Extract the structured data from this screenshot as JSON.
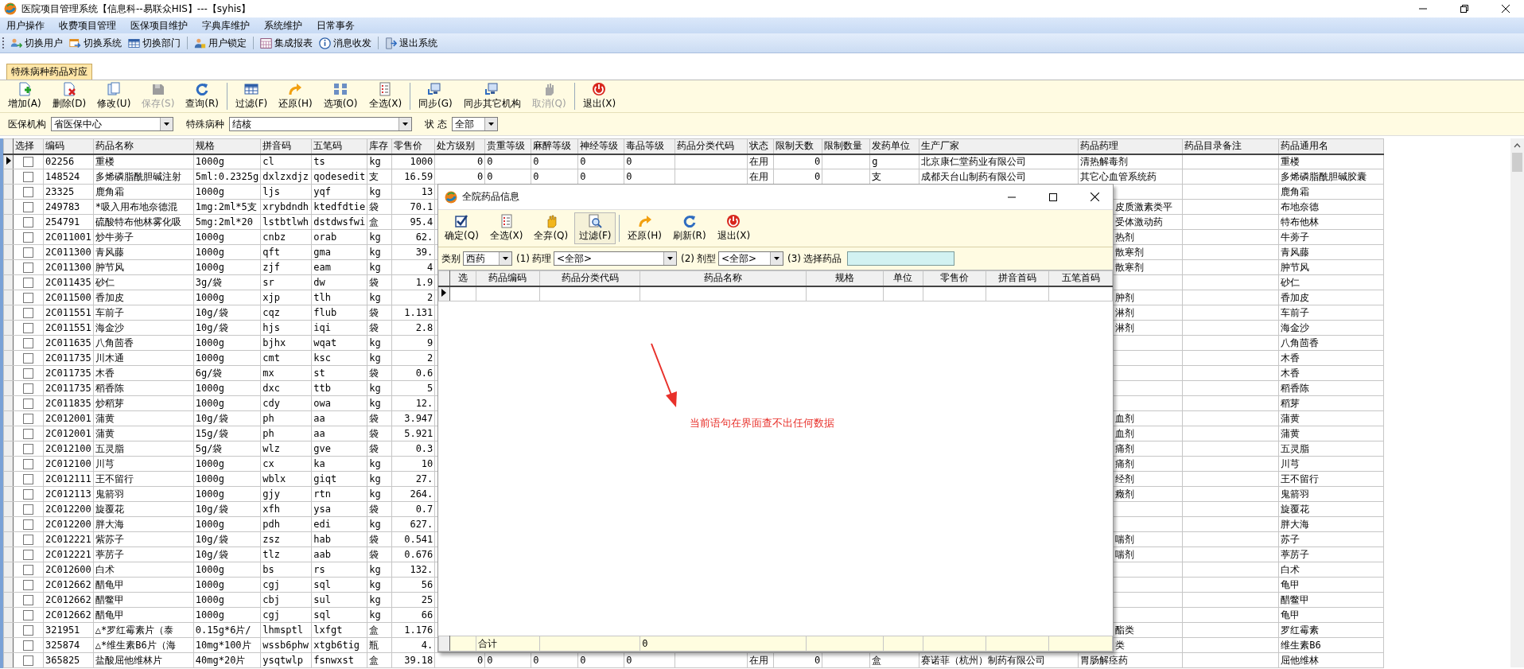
{
  "window": {
    "title": "医院项目管理系统【信息科--易联众HIS】---【syhis】"
  },
  "menu": [
    "用户操作",
    "收费项目管理",
    "医保项目维护",
    "字典库维护",
    "系统维护",
    "日常事务"
  ],
  "quickbar": [
    [
      "切换用户",
      "切换系统",
      "切换部门"
    ],
    [
      "用户锁定"
    ],
    [
      "集成报表",
      "消息收发"
    ],
    [
      "退出系统"
    ]
  ],
  "tabs": [
    {
      "label": "特殊病种药品对应",
      "selected": true
    }
  ],
  "actions": [
    [
      {
        "label": "增加(A)",
        "disabled": false
      },
      {
        "label": "删除(D)",
        "disabled": false
      },
      {
        "label": "修改(U)",
        "disabled": false
      },
      {
        "label": "保存(S)",
        "disabled": true
      },
      {
        "label": "查询(R)",
        "disabled": false
      }
    ],
    [
      {
        "label": "过滤(F)",
        "disabled": false
      },
      {
        "label": "还原(H)",
        "disabled": false
      },
      {
        "label": "选项(O)",
        "disabled": false
      },
      {
        "label": "全选(X)",
        "disabled": false
      }
    ],
    [
      {
        "label": "同步(G)",
        "disabled": false
      },
      {
        "label": "同步其它机构",
        "disabled": false
      },
      {
        "label": "取消(Q)",
        "disabled": true
      }
    ],
    [
      {
        "label": "退出(X)",
        "disabled": false
      }
    ]
  ],
  "filters": [
    {
      "label": "医保机构",
      "value": "省医保中心"
    },
    {
      "label": "特殊病种",
      "value": "结核"
    },
    {
      "label": "状 态",
      "value": "全部"
    }
  ],
  "grid": {
    "checkbox_column": "选择",
    "columns": [
      "编码",
      "药品名称",
      "规格",
      "拼音码",
      "五笔码",
      "库存",
      "零售价",
      "处方级别",
      "贵重等级",
      "麻醉等级",
      "神经等级",
      "毒品等级",
      "药品分类代码",
      "状态",
      "限制天数",
      "限制数量",
      "发药单位",
      "生产厂家",
      "药品药理",
      "药品目录备注",
      "药品通用名"
    ],
    "rows": [
      {
        "selected": true,
        "checked": false,
        "cells": [
          "02256",
          "重楼",
          "1000g",
          "cl",
          "ts",
          "kg",
          "1000"
        ],
        "middle": {
          "rx_level": "0",
          "value_level": "0",
          "narcotic_level": "0",
          "neuro_level": "0",
          "poison_level": "0",
          "status": "在用",
          "limit_days": "0",
          "dispense_unit": "g",
          "manufacturer": "北京康仁堂药业有限公司"
        },
        "pharmacology": "清热解毒剂",
        "common_name": "重楼"
      },
      {
        "selected": false,
        "checked": false,
        "cells": [
          "148524",
          "多烯磷脂酰胆碱注射",
          "5ml:0.2325g",
          "dxlzxdjz",
          "qodesedit",
          "支",
          "16.59"
        ],
        "middle": {
          "rx_level": "0",
          "value_level": "0",
          "narcotic_level": "0",
          "neuro_level": "0",
          "poison_level": "0",
          "status": "在用",
          "limit_days": "0",
          "dispense_unit": "支",
          "manufacturer": "成都天台山制药有限公司"
        },
        "pharmacology": "其它心血管系统药",
        "common_name": "多烯磷脂酰胆碱胶囊"
      },
      {
        "selected": false,
        "checked": false,
        "cells": [
          "23325",
          "鹿角霜",
          "1000g",
          "ljs",
          "yqf",
          "kg",
          "13"
        ],
        "common_name": "鹿角霜"
      },
      {
        "selected": false,
        "checked": false,
        "cells": [
          "249783",
          "*吸入用布地奈德混",
          "1mg:2ml*5支",
          "xrybdndh",
          "ktedfdtie",
          "袋",
          "70.1"
        ],
        "pharmacology": "皮质激素类平",
        "common_name": "布地奈德"
      },
      {
        "selected": false,
        "checked": false,
        "cells": [
          "254791",
          "硫酸特布他林雾化吸",
          "5mg:2ml*20",
          "lstbtlwh",
          "dstdwsfwi",
          "盒",
          "95.4"
        ],
        "pharmacology": "受体激动药",
        "common_name": "特布他林"
      },
      {
        "selected": false,
        "checked": false,
        "cells": [
          "2C011001",
          "炒牛蒡子",
          "1000g",
          "cnbz",
          "orab",
          "kg",
          "62."
        ],
        "pharmacology": "热剂",
        "common_name": "牛蒡子"
      },
      {
        "selected": false,
        "checked": false,
        "cells": [
          "2C011300",
          "青风藤",
          "1000g",
          "qft",
          "gma",
          "kg",
          "39."
        ],
        "pharmacology": "散寒剂",
        "common_name": "青风藤"
      },
      {
        "selected": false,
        "checked": false,
        "cells": [
          "2C011300",
          "肿节风",
          "1000g",
          "zjf",
          "eam",
          "kg",
          "4"
        ],
        "pharmacology": "散寒剂",
        "common_name": "肿节风"
      },
      {
        "selected": false,
        "checked": false,
        "cells": [
          "2C011435",
          "砂仁",
          "3g/袋",
          "sr",
          "dw",
          "袋",
          "1.9"
        ],
        "common_name": "砂仁"
      },
      {
        "selected": false,
        "checked": false,
        "cells": [
          "2C011500",
          "香加皮",
          "1000g",
          "xjp",
          "tlh",
          "kg",
          "2"
        ],
        "pharmacology": "肿剂",
        "common_name": "香加皮"
      },
      {
        "selected": false,
        "checked": false,
        "cells": [
          "2C011551",
          "车前子",
          "10g/袋",
          "cqz",
          "flub",
          "袋",
          "1.131"
        ],
        "pharmacology": "淋剂",
        "common_name": "车前子"
      },
      {
        "selected": false,
        "checked": false,
        "cells": [
          "2C011551",
          "海金沙",
          "10g/袋",
          "hjs",
          "iqi",
          "袋",
          "2.8"
        ],
        "pharmacology": "淋剂",
        "common_name": "海金沙"
      },
      {
        "selected": false,
        "checked": false,
        "cells": [
          "2C011635",
          "八角茴香",
          "1000g",
          "bjhx",
          "wqat",
          "kg",
          "9"
        ],
        "common_name": "八角茴香"
      },
      {
        "selected": false,
        "checked": false,
        "cells": [
          "2C011735",
          "川木通",
          "1000g",
          "cmt",
          "ksc",
          "kg",
          "2"
        ],
        "common_name": "木香"
      },
      {
        "selected": false,
        "checked": false,
        "cells": [
          "2C011735",
          "木香",
          "6g/袋",
          "mx",
          "st",
          "袋",
          "0.6"
        ],
        "common_name": "木香"
      },
      {
        "selected": false,
        "checked": false,
        "cells": [
          "2C011735",
          "稻香陈",
          "1000g",
          "dxc",
          "ttb",
          "kg",
          "5"
        ],
        "common_name": "稻香陈"
      },
      {
        "selected": false,
        "checked": false,
        "cells": [
          "2C011835",
          "炒稻芽",
          "1000g",
          "cdy",
          "owa",
          "kg",
          "12."
        ],
        "common_name": "稻芽"
      },
      {
        "selected": false,
        "checked": false,
        "cells": [
          "2C012001",
          "蒲黄",
          "10g/袋",
          "ph",
          "aa",
          "袋",
          "3.947"
        ],
        "pharmacology": "血剂",
        "common_name": "蒲黄"
      },
      {
        "selected": false,
        "checked": false,
        "cells": [
          "2C012001",
          "蒲黄",
          "15g/袋",
          "ph",
          "aa",
          "袋",
          "5.921"
        ],
        "pharmacology": "血剂",
        "common_name": "蒲黄"
      },
      {
        "selected": false,
        "checked": false,
        "cells": [
          "2C012100",
          "五灵脂",
          "5g/袋",
          "wlz",
          "gve",
          "袋",
          "0.3"
        ],
        "pharmacology": "痛剂",
        "common_name": "五灵脂"
      },
      {
        "selected": false,
        "checked": false,
        "cells": [
          "2C012100",
          "川芎",
          "1000g",
          "cx",
          "ka",
          "kg",
          "10"
        ],
        "pharmacology": "痛剂",
        "common_name": "川芎"
      },
      {
        "selected": false,
        "checked": false,
        "cells": [
          "2C012111",
          "王不留行",
          "1000g",
          "wblx",
          "giqt",
          "kg",
          "27."
        ],
        "pharmacology": "经剂",
        "common_name": "王不留行"
      },
      {
        "selected": false,
        "checked": false,
        "cells": [
          "2C012113",
          "鬼箭羽",
          "1000g",
          "gjy",
          "rtn",
          "kg",
          "264."
        ],
        "pharmacology": "癥剂",
        "common_name": "鬼箭羽"
      },
      {
        "selected": false,
        "checked": false,
        "cells": [
          "2C012200",
          "旋覆花",
          "10g/袋",
          "xfh",
          "ysa",
          "袋",
          "0.7"
        ],
        "common_name": "旋覆花"
      },
      {
        "selected": false,
        "checked": false,
        "cells": [
          "2C012200",
          "胖大海",
          "1000g",
          "pdh",
          "edi",
          "kg",
          "627."
        ],
        "common_name": "胖大海"
      },
      {
        "selected": false,
        "checked": false,
        "cells": [
          "2C012221",
          "紫苏子",
          "10g/袋",
          "zsz",
          "hab",
          "袋",
          "0.541"
        ],
        "pharmacology": "喘剂",
        "common_name": "苏子"
      },
      {
        "selected": false,
        "checked": false,
        "cells": [
          "2C012221",
          "葶苈子",
          "10g/袋",
          "tlz",
          "aab",
          "袋",
          "0.676"
        ],
        "pharmacology": "喘剂",
        "common_name": "葶苈子"
      },
      {
        "selected": false,
        "checked": false,
        "cells": [
          "2C012600",
          "白术",
          "1000g",
          "bs",
          "rs",
          "kg",
          "132."
        ],
        "common_name": "白术"
      },
      {
        "selected": false,
        "checked": false,
        "cells": [
          "2C012662",
          "醋龟甲",
          "1000g",
          "cgj",
          "sql",
          "kg",
          "56"
        ],
        "common_name": "龟甲"
      },
      {
        "selected": false,
        "checked": false,
        "cells": [
          "2C012662",
          "醋鳖甲",
          "1000g",
          "cbj",
          "sul",
          "kg",
          "25"
        ],
        "common_name": "醋鳖甲"
      },
      {
        "selected": false,
        "checked": false,
        "cells": [
          "2C012662",
          "醋龟甲",
          "1000g",
          "cgj",
          "sql",
          "kg",
          "66"
        ],
        "common_name": "龟甲"
      },
      {
        "selected": false,
        "checked": false,
        "cells": [
          "321951",
          "△*罗红霉素片（泰",
          "0.15g*6片/",
          "lhmsptl",
          "lxfgt",
          "盒",
          "1.176"
        ],
        "pharmacology": "酯类",
        "common_name": "罗红霉素"
      },
      {
        "selected": false,
        "checked": false,
        "cells": [
          "325874",
          "△*维生素B6片（海",
          "10mg*100片",
          "wssb6phw",
          "xtgb6tig",
          "瓶",
          "4."
        ],
        "pharmacology": "类",
        "common_name": "维生素B6"
      },
      {
        "selected": false,
        "checked": false,
        "cells": [
          "365825",
          "盐酸屈他维林片",
          "40mg*20片",
          "ysqtwlp",
          "fsnwxst",
          "盒",
          "39.18"
        ],
        "middle": {
          "rx_level": "0",
          "value_level": "0",
          "narcotic_level": "0",
          "neuro_level": "0",
          "poison_level": "0",
          "status": "在用",
          "limit_days": "0",
          "dispense_unit": "盒",
          "manufacturer": "赛诺菲（杭州）制药有限公司"
        },
        "pharmacology": "胃肠解痉药",
        "common_name": "屈他维林"
      }
    ]
  },
  "dialog": {
    "title": "全院药品信息",
    "actions": [
      [
        {
          "label": "确定(Q)",
          "pressed": false
        },
        {
          "label": "全选(X)",
          "pressed": false
        },
        {
          "label": "全弃(Q)",
          "pressed": false
        },
        {
          "label": "过滤(F)",
          "pressed": true
        }
      ],
      [
        {
          "label": "还原(H)",
          "pressed": false
        },
        {
          "label": "刷新(R)",
          "pressed": false
        },
        {
          "label": "退出(X)",
          "pressed": false
        }
      ]
    ],
    "filters": [
      {
        "label": "类别",
        "value": "西药"
      },
      {
        "step": "(1)",
        "label": "药理",
        "value": "<全部>"
      },
      {
        "step": "(2)",
        "label": "剂型",
        "value": "<全部>"
      }
    ],
    "search": {
      "step": "(3)",
      "label": "选择药品"
    },
    "columns": [
      "选",
      "药品编码",
      "药品分类代码",
      "药品名称",
      "规格",
      "单位",
      "零售价",
      "拼音首码",
      "五笔首码"
    ],
    "total": {
      "label": "合计",
      "value": "0"
    },
    "annotation": "当前语句在界面查不出任何数据"
  }
}
